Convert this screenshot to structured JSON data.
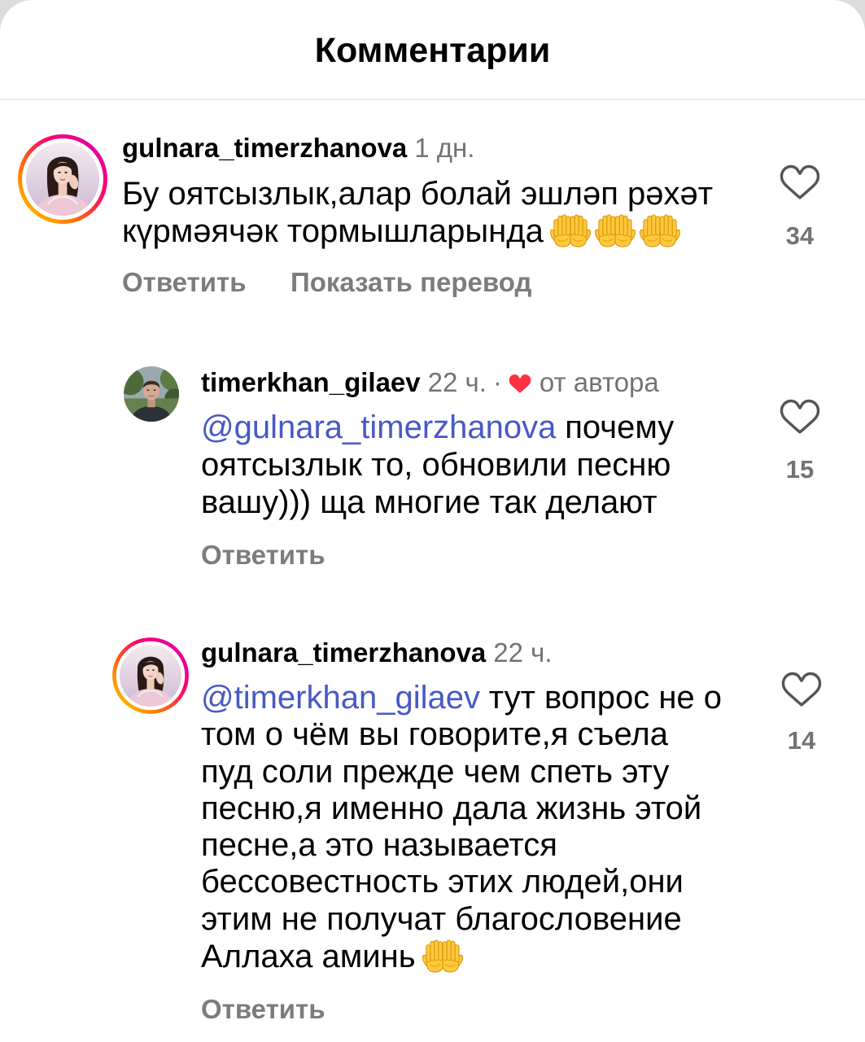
{
  "colors": {
    "text": "#000000",
    "secondary": "#737373",
    "action": "#7c7c7c",
    "mention": "#4759c5",
    "like_icon": "#555555",
    "author_heart": "#ff3040",
    "divider": "#ececec"
  },
  "header": {
    "title": "Комментарии"
  },
  "comments": [
    {
      "username": "gulnara_timerzhanova",
      "time": "1 дн.",
      "lines": [
        "Бу оятсызлык,алар болай эшләп рәхәт",
        "күрмәячәк тормышларында"
      ],
      "emoji": [
        "palms-up-together-icon",
        "palms-up-together-icon",
        "palms-up-together-icon"
      ],
      "like_icon": "heart-outline-icon",
      "likes": "34",
      "reply_label": "Ответить",
      "translate_label": "Показать перевод"
    },
    {
      "username": "timerkhan_gilaev",
      "time": "22 ч.",
      "separator": "·",
      "author_like_icon": "red-heart-icon",
      "author_label": "от автора",
      "mention": "@gulnara_timerzhanova",
      "lines": [
        "почему",
        "оятсызлык то, обновили песню",
        "вашу))) ща многие так делают"
      ],
      "like_icon": "heart-outline-icon",
      "likes": "15",
      "reply_label": "Ответить"
    },
    {
      "username": "gulnara_timerzhanova",
      "time": "22 ч.",
      "mention": "@timerkhan_gilaev",
      "lines": [
        "тут вопрос не о",
        "том о чём вы говорите,я съела",
        "пуд соли прежде чем спеть эту",
        "песню,я именно дала жизнь этой",
        "песне,а это называется",
        "бессовестность этих людей,они",
        "этим не получат благословение",
        "Аллаха аминь"
      ],
      "emoji": [
        "palms-up-together-icon"
      ],
      "like_icon": "heart-outline-icon",
      "likes": "14",
      "reply_label": "Ответить"
    }
  ]
}
